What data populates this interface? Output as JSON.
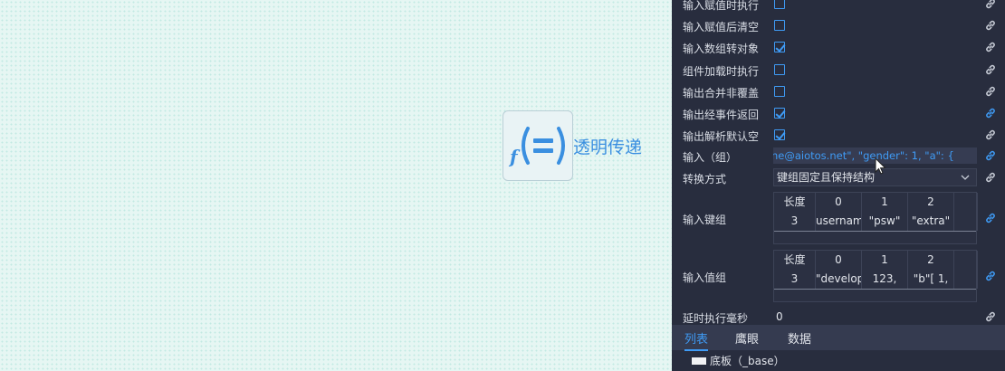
{
  "widget": {
    "label": "透明传递",
    "icon": "function-equals-icon"
  },
  "panel": {
    "checkbox_rows": [
      {
        "label": "输入赋值时执行",
        "checked": false,
        "link_active": false
      },
      {
        "label": "输入赋值后清空",
        "checked": false,
        "link_active": false
      },
      {
        "label": "输入数组转对象",
        "checked": true,
        "link_active": false
      },
      {
        "label": "组件加载时执行",
        "checked": false,
        "link_active": false
      },
      {
        "label": "输出合并非覆盖",
        "checked": false,
        "link_active": false
      },
      {
        "label": "输出经事件返回",
        "checked": true,
        "link_active": true
      },
      {
        "label": "输出解析默认空",
        "checked": true,
        "link_active": false
      }
    ],
    "input_group": {
      "label": "输入（组）",
      "value": "ne@aiotos.net\",    \"gender\": 1,     \"a\": {"
    },
    "transform": {
      "label": "转换方式",
      "value": "键组固定且保持结构"
    },
    "key_group": {
      "label": "输入键组",
      "headers": [
        "长度",
        "0",
        "1",
        "2"
      ],
      "values": [
        "3",
        "username",
        "\"psw\"",
        "\"extra\""
      ]
    },
    "value_group": {
      "label": "输入值组",
      "headers": [
        "长度",
        "0",
        "1",
        "2"
      ],
      "values": [
        "3",
        "\"develop",
        "123,",
        "\"b\"[       1,"
      ]
    },
    "delay": {
      "label": "延时执行毫秒",
      "value": "0"
    }
  },
  "tabs": [
    "列表",
    "鹰眼",
    "数据"
  ],
  "layer": {
    "label": "底板（_base）"
  },
  "colors": {
    "accent": "#3f9bf5",
    "panel_bg": "#282d3e"
  }
}
